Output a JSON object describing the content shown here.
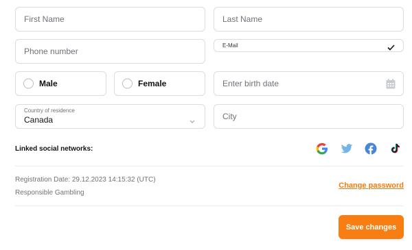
{
  "form": {
    "first_name": {
      "placeholder": "First Name"
    },
    "last_name": {
      "placeholder": "Last Name"
    },
    "phone": {
      "placeholder": "Phone number"
    },
    "email": {
      "label": "E-Mail",
      "value": ""
    },
    "gender": {
      "male": "Male",
      "female": "Female",
      "selected": ""
    },
    "birth_date": {
      "placeholder": "Enter birth date"
    },
    "country": {
      "label": "Country of residence",
      "value": "Canada"
    },
    "city": {
      "placeholder": "City"
    }
  },
  "social": {
    "label": "Linked social networks:",
    "networks": [
      "google-icon",
      "twitter-icon",
      "facebook-icon",
      "tiktok-icon"
    ]
  },
  "info": {
    "registration_date": "Registration Date: 29.12.2023 14:15:32 (UTC)",
    "responsible_gambling": "Responsible Gambling",
    "change_password": "Change password"
  },
  "actions": {
    "save_label": "Save changes"
  },
  "colors": {
    "accent": "#f77e12",
    "link": "#f47a10",
    "border": "#d9dce1",
    "muted_text": "#6f7278"
  }
}
